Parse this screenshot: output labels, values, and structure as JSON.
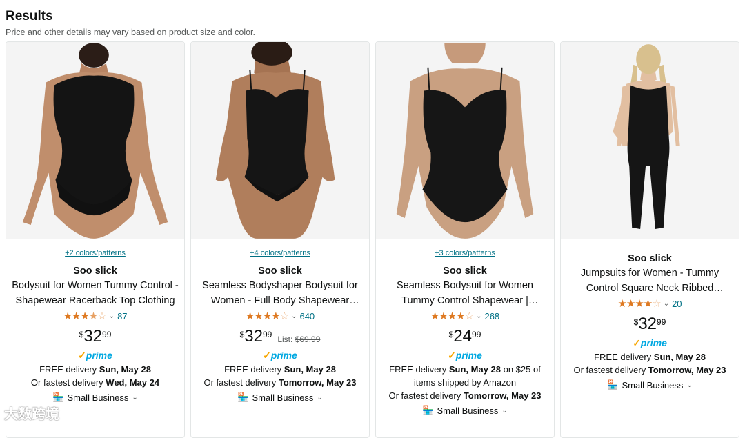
{
  "header": {
    "title": "Results",
    "subtitle": "Price and other details may vary based on product size and color."
  },
  "products": [
    {
      "colors": "+2 colors/patterns",
      "brand": "Soo slick",
      "title": "Bodysuit for Women Tummy Control - Shapewear Racerback Top Clothing",
      "rating": 3.5,
      "review_count": "87",
      "price_symbol": "$",
      "price_whole": "32",
      "price_fraction": "99",
      "list_label": "",
      "list_price": "",
      "prime": "prime",
      "delivery_free_prefix": "FREE delivery ",
      "delivery_free_date": "Sun, May 28",
      "delivery_free_suffix": "",
      "delivery_line2": "",
      "delivery_fast_prefix": "Or fastest delivery ",
      "delivery_fast_date": "Wed, May 24",
      "small_business": "Small Business",
      "image": "bodysuit-racerback-model"
    },
    {
      "colors": "+4 colors/patterns",
      "brand": "Soo slick",
      "title": "Seamless Bodyshaper Bodysuit for Women - Full Body Shapewear Bodysuit",
      "rating": 4,
      "review_count": "640",
      "price_symbol": "$",
      "price_whole": "32",
      "price_fraction": "99",
      "list_label": "List: ",
      "list_price": "$69.99",
      "prime": "prime",
      "delivery_free_prefix": "FREE delivery ",
      "delivery_free_date": "Sun, May 28",
      "delivery_free_suffix": "",
      "delivery_line2": "",
      "delivery_fast_prefix": "Or fastest delivery ",
      "delivery_fast_date": "Tomorrow, May 23",
      "small_business": "Small Business",
      "image": "bodyshaper-spaghetti-model"
    },
    {
      "colors": "+3 colors/patterns",
      "brand": "Soo slick",
      "title": "Seamless Bodysuit for Women Tummy Control Shapewear | Sculpting",
      "rating": 4,
      "review_count": "268",
      "price_symbol": "$",
      "price_whole": "24",
      "price_fraction": "99",
      "list_label": "",
      "list_price": "",
      "prime": "prime",
      "delivery_free_prefix": "FREE delivery ",
      "delivery_free_date": "Sun, May 28",
      "delivery_free_suffix": " on $25 of",
      "delivery_line2": "items shipped by Amazon",
      "delivery_fast_prefix": "Or fastest delivery ",
      "delivery_fast_date": "Tomorrow, May 23",
      "small_business": "Small Business",
      "image": "bodysuit-vneck-model"
    },
    {
      "colors": "",
      "brand": "Soo slick",
      "title": "Jumpsuits for Women - Tummy Control Square Neck Ribbed Jumpsuit",
      "rating": 4,
      "review_count": "20",
      "price_symbol": "$",
      "price_whole": "32",
      "price_fraction": "99",
      "list_label": "",
      "list_price": "",
      "prime": "prime",
      "delivery_free_prefix": "FREE delivery ",
      "delivery_free_date": "Sun, May 28",
      "delivery_free_suffix": "",
      "delivery_line2": "",
      "delivery_fast_prefix": "Or fastest delivery ",
      "delivery_fast_date": "Tomorrow, May 23",
      "small_business": "Small Business",
      "image": "jumpsuit-model"
    }
  ],
  "watermark": "大数跨境",
  "colors": {
    "link": "#007185",
    "star": "#de7921",
    "prime_blue": "#00a8e1",
    "prime_check": "#f7a600"
  }
}
